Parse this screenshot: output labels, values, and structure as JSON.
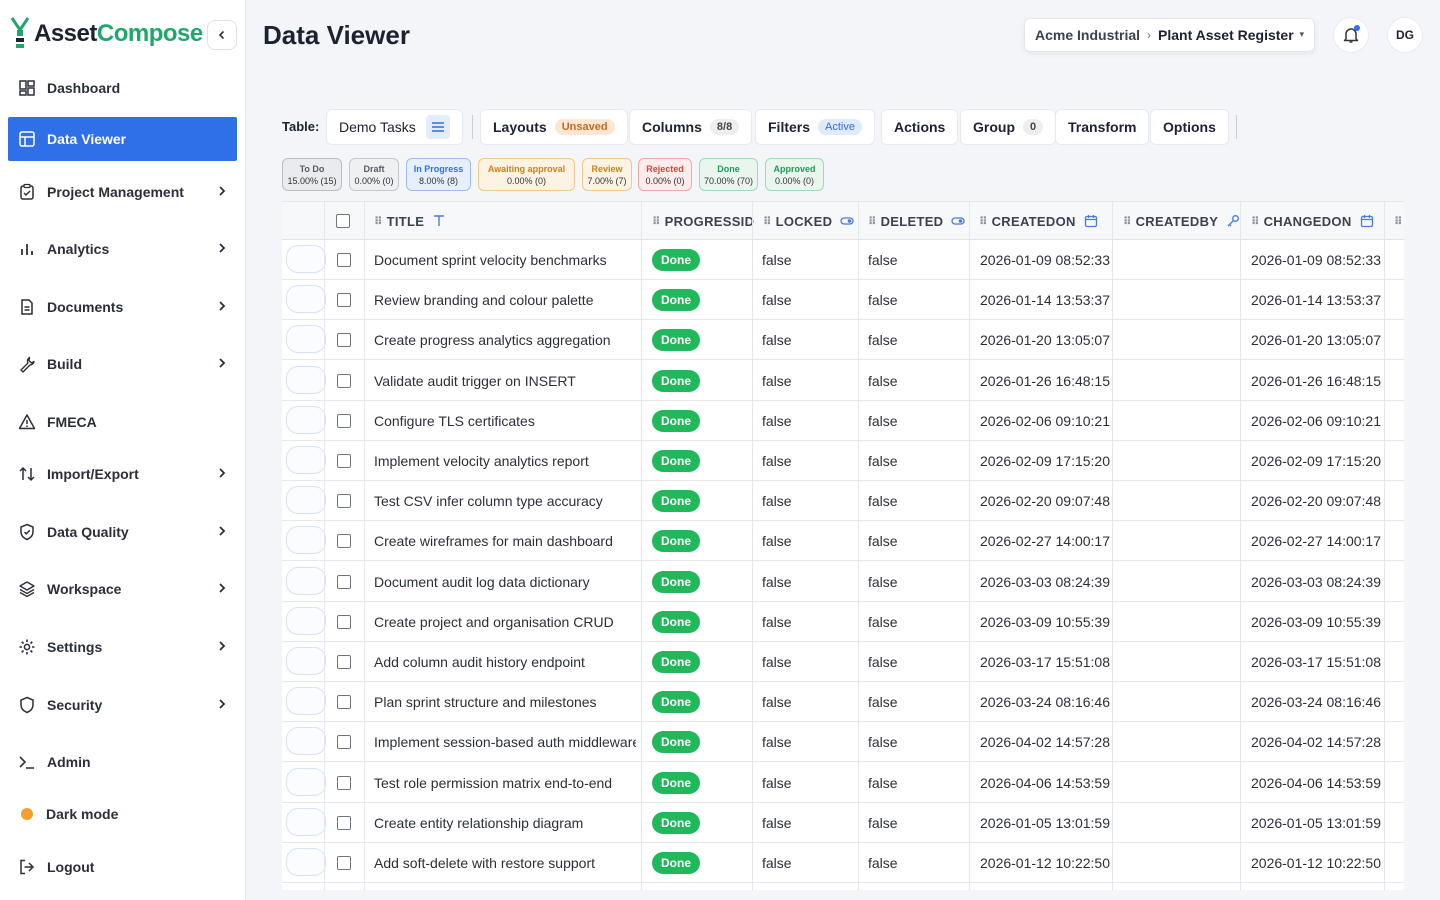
{
  "app": {
    "name_part1": "Asset",
    "name_part2": "Compose"
  },
  "sidebar": {
    "items": [
      {
        "label": "Dashboard",
        "icon": "dashboard-icon",
        "chevron": false
      },
      {
        "label": "Data Viewer",
        "icon": "table-icon",
        "chevron": false,
        "active": true
      },
      {
        "label": "Project Management",
        "icon": "clipboard-icon",
        "chevron": true
      },
      {
        "label": "Analytics",
        "icon": "bar-chart-icon",
        "chevron": true
      },
      {
        "label": "Documents",
        "icon": "document-icon",
        "chevron": true
      },
      {
        "label": "Build",
        "icon": "wrench-icon",
        "chevron": true
      },
      {
        "label": "FMECA",
        "icon": "warning-icon",
        "chevron": false
      },
      {
        "label": "Import/Export",
        "icon": "import-export-icon",
        "chevron": true
      },
      {
        "label": "Data Quality",
        "icon": "shield-check-icon",
        "chevron": true
      },
      {
        "label": "Workspace",
        "icon": "layers-icon",
        "chevron": true
      },
      {
        "label": "Settings",
        "icon": "gear-icon",
        "chevron": true
      },
      {
        "label": "Security",
        "icon": "shield-icon",
        "chevron": true
      },
      {
        "label": "Admin",
        "icon": "terminal-icon",
        "chevron": false
      },
      {
        "label": "Dark mode",
        "icon": "dark-mode-dot",
        "chevron": false
      },
      {
        "label": "Logout",
        "icon": "logout-icon",
        "chevron": false
      }
    ]
  },
  "header": {
    "title": "Data Viewer",
    "org": "Acme Industrial",
    "separator": "›",
    "table": "Plant Asset Register",
    "avatar_initials": "DG"
  },
  "toolbar": {
    "table_label": "Table:",
    "table_name": "Demo Tasks",
    "layouts_label": "Layouts",
    "layouts_badge": "Unsaved",
    "columns_label": "Columns",
    "columns_badge": "8/8",
    "filters_label": "Filters",
    "filters_badge": "Active",
    "actions_label": "Actions",
    "group_label": "Group",
    "group_badge": "0",
    "transform_label": "Transform",
    "options_label": "Options"
  },
  "status_chips": [
    {
      "name": "To Do",
      "value": "15.00% (15)",
      "color": "#555b66",
      "bg": "#e9ebee",
      "border": "#b9bec6"
    },
    {
      "name": "Draft",
      "value": "0.00% (0)",
      "color": "#555b66",
      "bg": "#eef0f2",
      "border": "#c3c8cf"
    },
    {
      "name": "In Progress",
      "value": "8.00% (8)",
      "color": "#2f6fe8",
      "bg": "#e6effd",
      "border": "#9dbcf2"
    },
    {
      "name": "Awaiting approval",
      "value": "0.00% (0)",
      "color": "#c9821c",
      "bg": "#fdf3e3",
      "border": "#f0c98a"
    },
    {
      "name": "Review",
      "value": "7.00% (7)",
      "color": "#c9821c",
      "bg": "#fdf3e3",
      "border": "#f0c98a"
    },
    {
      "name": "Rejected",
      "value": "0.00% (0)",
      "color": "#d0453f",
      "bg": "#fdeceb",
      "border": "#f0a8a4"
    },
    {
      "name": "Done",
      "value": "70.00% (70)",
      "color": "#1f9d55",
      "bg": "#e8f6ee",
      "border": "#9fd9b6"
    },
    {
      "name": "Approved",
      "value": "0.00% (0)",
      "color": "#1f9d55",
      "bg": "#e8f6ee",
      "border": "#9fd9b6"
    }
  ],
  "table": {
    "columns": [
      "TITLE",
      "PROGRESSID",
      "LOCKED",
      "DELETED",
      "CREATEDON",
      "CREATEDBY",
      "CHANGEDON"
    ],
    "rows": [
      {
        "title": "Document sprint velocity benchmarks",
        "progress": "Done",
        "locked": "false",
        "deleted": "false",
        "createdon": "2026-01-09 08:52:33",
        "createdby": "",
        "changedon": "2026-01-09 08:52:33"
      },
      {
        "title": "Review branding and colour palette",
        "progress": "Done",
        "locked": "false",
        "deleted": "false",
        "createdon": "2026-01-14 13:53:37",
        "createdby": "",
        "changedon": "2026-01-14 13:53:37"
      },
      {
        "title": "Create progress analytics aggregation",
        "progress": "Done",
        "locked": "false",
        "deleted": "false",
        "createdon": "2026-01-20 13:05:07",
        "createdby": "",
        "changedon": "2026-01-20 13:05:07"
      },
      {
        "title": "Validate audit trigger on INSERT",
        "progress": "Done",
        "locked": "false",
        "deleted": "false",
        "createdon": "2026-01-26 16:48:15",
        "createdby": "",
        "changedon": "2026-01-26 16:48:15"
      },
      {
        "title": "Configure TLS certificates",
        "progress": "Done",
        "locked": "false",
        "deleted": "false",
        "createdon": "2026-02-06 09:10:21",
        "createdby": "",
        "changedon": "2026-02-06 09:10:21"
      },
      {
        "title": "Implement velocity analytics report",
        "progress": "Done",
        "locked": "false",
        "deleted": "false",
        "createdon": "2026-02-09 17:15:20",
        "createdby": "",
        "changedon": "2026-02-09 17:15:20"
      },
      {
        "title": "Test CSV infer column type accuracy",
        "progress": "Done",
        "locked": "false",
        "deleted": "false",
        "createdon": "2026-02-20 09:07:48",
        "createdby": "",
        "changedon": "2026-02-20 09:07:48"
      },
      {
        "title": "Create wireframes for main dashboard",
        "progress": "Done",
        "locked": "false",
        "deleted": "false",
        "createdon": "2026-02-27 14:00:17",
        "createdby": "",
        "changedon": "2026-02-27 14:00:17"
      },
      {
        "title": "Document audit log data dictionary",
        "progress": "Done",
        "locked": "false",
        "deleted": "false",
        "createdon": "2026-03-03 08:24:39",
        "createdby": "",
        "changedon": "2026-03-03 08:24:39"
      },
      {
        "title": "Create project and organisation CRUD",
        "progress": "Done",
        "locked": "false",
        "deleted": "false",
        "createdon": "2026-03-09 10:55:39",
        "createdby": "",
        "changedon": "2026-03-09 10:55:39"
      },
      {
        "title": "Add column audit history endpoint",
        "progress": "Done",
        "locked": "false",
        "deleted": "false",
        "createdon": "2026-03-17 15:51:08",
        "createdby": "",
        "changedon": "2026-03-17 15:51:08"
      },
      {
        "title": "Plan sprint structure and milestones",
        "progress": "Done",
        "locked": "false",
        "deleted": "false",
        "createdon": "2026-03-24 08:16:46",
        "createdby": "",
        "changedon": "2026-03-24 08:16:46"
      },
      {
        "title": "Implement session-based auth middleware",
        "progress": "Done",
        "locked": "false",
        "deleted": "false",
        "createdon": "2026-04-02 14:57:28",
        "createdby": "",
        "changedon": "2026-04-02 14:57:28"
      },
      {
        "title": "Test role permission matrix end-to-end",
        "progress": "Done",
        "locked": "false",
        "deleted": "false",
        "createdon": "2026-04-06 14:53:59",
        "createdby": "",
        "changedon": "2026-04-06 14:53:59"
      },
      {
        "title": "Create entity relationship diagram",
        "progress": "Done",
        "locked": "false",
        "deleted": "false",
        "createdon": "2026-01-05 13:01:59",
        "createdby": "",
        "changedon": "2026-01-05 13:01:59"
      },
      {
        "title": "Add soft-delete with restore support",
        "progress": "Done",
        "locked": "false",
        "deleted": "false",
        "createdon": "2026-01-12 10:22:50",
        "createdby": "",
        "changedon": "2026-01-12 10:22:50"
      }
    ]
  },
  "colors": {
    "accent": "#2f6fe8",
    "brand_green": "#1ea86b",
    "done_green": "#20b85a"
  }
}
